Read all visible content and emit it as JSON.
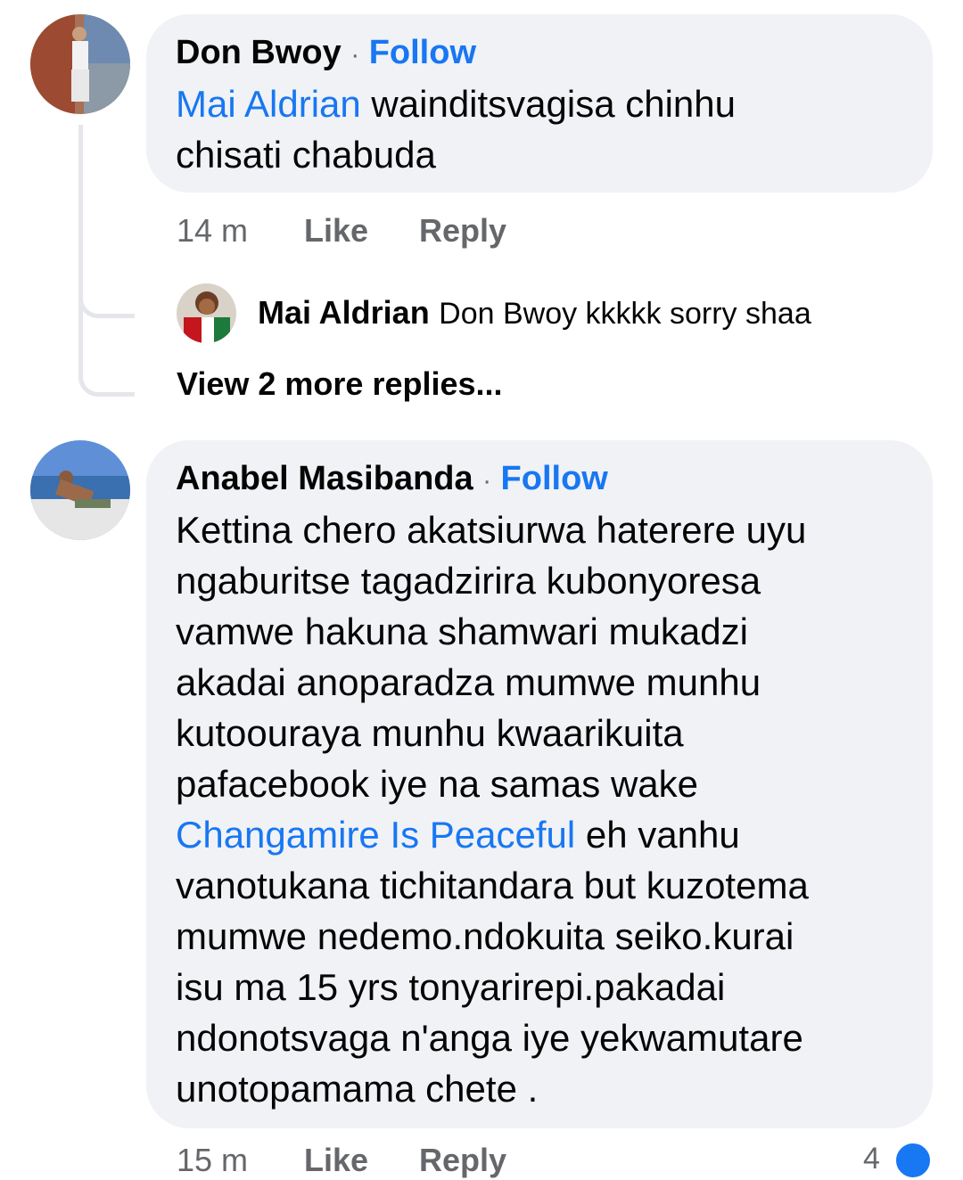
{
  "comment1": {
    "author": "Don Bwoy",
    "separator": "·",
    "follow": "Follow",
    "mention": "Mai Aldrian",
    "text_line1": " wainditsvagisa chinhu",
    "text_line2": "chisati chabuda",
    "time": "14 m",
    "like": "Like",
    "reply": "Reply"
  },
  "reply1": {
    "author": "Mai Aldrian",
    "text": "Don Bwoy kkkkk sorry shaa"
  },
  "view_more": "View 2 more replies...",
  "comment2": {
    "author": "Anabel Masibanda",
    "separator": "·",
    "follow": "Follow",
    "lines": [
      "Kettina chero akatsiurwa haterere uyu",
      "ngaburitse tagadzirira kubonyoresa",
      "vamwe hakuna shamwari mukadzi",
      "akadai anoparadza mumwe munhu",
      "kutoouraya munhu kwaarikuita",
      "pafacebook iye na samas wake"
    ],
    "mention": "Changamire Is Peaceful",
    "mention_after": " eh vanhu",
    "lines2": [
      "vanotukana tichitandara but kuzotema",
      "mumwe nedemo.ndokuita seiko.kurai",
      "isu ma 15 yrs tonyarirepi.pakadai",
      "ndonotsvaga  n'anga iye yekwamutare",
      "unotopamama chete ."
    ],
    "time_partial": "15 m",
    "like_partial": "Like",
    "reply_partial": "Reply",
    "reaction_count": "4"
  },
  "colors": {
    "link": "#1877f2",
    "bubble": "#f0f2f5",
    "meta": "#65676b"
  }
}
